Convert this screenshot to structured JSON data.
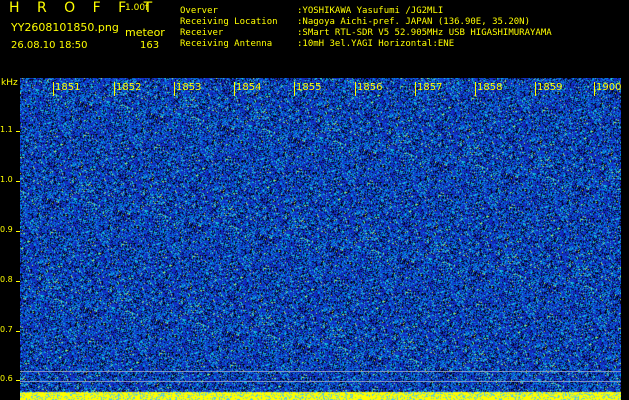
{
  "header": {
    "logo": "H R O F F T",
    "version": "1.00f",
    "filename": "YY2608101850.png",
    "mode": "meteor",
    "datetime": "26.08.10 18:50",
    "count": "163"
  },
  "info": [
    {
      "label": "Overver",
      "value": ":YOSHIKAWA Yasufumi /JG2MLI"
    },
    {
      "label": "Receiving Location",
      "value": ":Nagoya Aichi-pref. JAPAN (136.90E, 35.20N)"
    },
    {
      "label": "Receiver",
      "value": ":SMart RTL-SDR V5 52.905MHz USB HIGASHIMURAYAMA"
    },
    {
      "label": "Receiving Antenna",
      "value": ":10mH 3el.YAGI Horizontal:ENE"
    }
  ],
  "y_axis": {
    "unit": "kHz",
    "ticks": [
      "1.1",
      "1.0",
      "0.9",
      "0.8",
      "0.7",
      "0.6"
    ]
  },
  "x_axis": {
    "ticks": [
      "1851",
      "1852",
      "1853",
      "1854",
      "1855",
      "1856",
      "1857",
      "1858",
      "1859",
      "1900"
    ]
  },
  "colors": {
    "text": "#ffff00",
    "background": "#000000",
    "spectrogram_base": "#1a2fb0",
    "baseline_bar": "#ffff00"
  }
}
